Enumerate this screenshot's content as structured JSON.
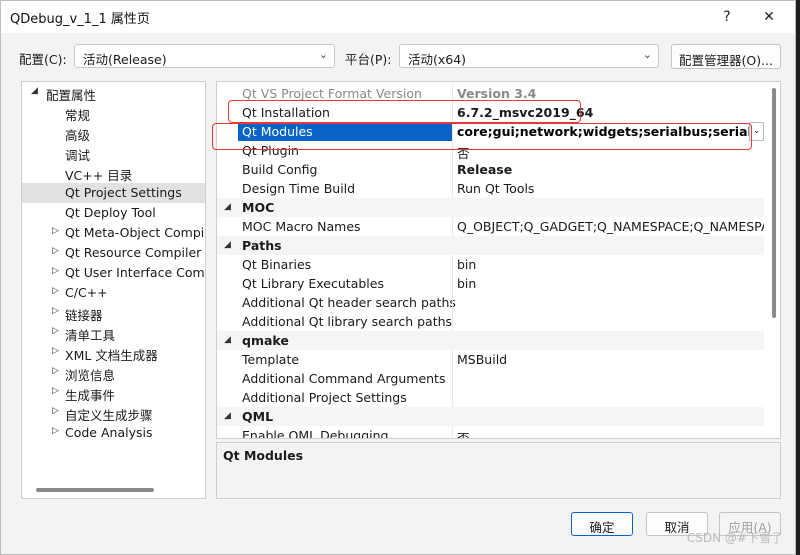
{
  "window": {
    "title": "QDebug_v_1_1 属性页",
    "help_label": "?",
    "close_label": "✕"
  },
  "config": {
    "config_label": "配置(C):",
    "config_value": "活动(Release)",
    "platform_label": "平台(P):",
    "platform_value": "活动(x64)",
    "manager_label": "配置管理器(O)..."
  },
  "tree": {
    "root": "配置属性",
    "items": [
      {
        "label": "常规",
        "expand": false
      },
      {
        "label": "高级",
        "expand": false
      },
      {
        "label": "调试",
        "expand": false
      },
      {
        "label": "VC++ 目录",
        "expand": false
      },
      {
        "label": "Qt Project Settings",
        "expand": false,
        "selected": true
      },
      {
        "label": "Qt Deploy Tool",
        "expand": false
      },
      {
        "label": "Qt Meta-Object Compiler",
        "expand": true
      },
      {
        "label": "Qt Resource Compiler",
        "expand": true
      },
      {
        "label": "Qt User Interface Compiler",
        "expand": true
      },
      {
        "label": "C/C++",
        "expand": true
      },
      {
        "label": "链接器",
        "expand": true
      },
      {
        "label": "清单工具",
        "expand": true
      },
      {
        "label": "XML 文档生成器",
        "expand": true
      },
      {
        "label": "浏览信息",
        "expand": true
      },
      {
        "label": "生成事件",
        "expand": true
      },
      {
        "label": "自定义生成步骤",
        "expand": true
      },
      {
        "label": "Code Analysis",
        "expand": true
      }
    ]
  },
  "grid": {
    "rows": [
      {
        "type": "prop",
        "name": "Qt VS Project Format Version",
        "value": "Version 3.4",
        "style": "faded"
      },
      {
        "type": "prop",
        "name": "Qt Installation",
        "value": "6.7.2_msvc2019_64",
        "style": "bold"
      },
      {
        "type": "prop",
        "name": "Qt Modules",
        "value": "core;gui;network;widgets;serialbus;serialport",
        "style": "highlight"
      },
      {
        "type": "prop",
        "name": "Qt Plugin",
        "value": "否"
      },
      {
        "type": "prop",
        "name": "Build Config",
        "value": "Release",
        "style": "bold"
      },
      {
        "type": "prop",
        "name": "Design Time Build",
        "value": "Run Qt Tools"
      },
      {
        "type": "cat",
        "name": "MOC"
      },
      {
        "type": "prop",
        "name": "MOC Macro Names",
        "value": "Q_OBJECT;Q_GADGET;Q_NAMESPACE;Q_NAMESPACE_EXPORT"
      },
      {
        "type": "cat",
        "name": "Paths"
      },
      {
        "type": "prop",
        "name": "Qt Binaries",
        "value": "bin"
      },
      {
        "type": "prop",
        "name": "Qt Library Executables",
        "value": "bin"
      },
      {
        "type": "prop",
        "name": "Additional Qt header search paths",
        "value": ""
      },
      {
        "type": "prop",
        "name": "Additional Qt library search paths",
        "value": ""
      },
      {
        "type": "cat",
        "name": "qmake"
      },
      {
        "type": "prop",
        "name": "Template",
        "value": "MSBuild"
      },
      {
        "type": "prop",
        "name": "Additional Command Arguments",
        "value": ""
      },
      {
        "type": "prop",
        "name": "Additional Project Settings",
        "value": ""
      },
      {
        "type": "cat",
        "name": "QML"
      },
      {
        "type": "prop",
        "name": "Enable QML Debugging",
        "value": "否"
      }
    ]
  },
  "description": {
    "title": "Qt Modules"
  },
  "buttons": {
    "ok": "确定",
    "cancel": "取消",
    "apply": "应用(A)"
  },
  "watermark": "CSDN @#下雪了",
  "colors": {
    "accent": "#0a64c8",
    "annotation": "#e53935"
  }
}
